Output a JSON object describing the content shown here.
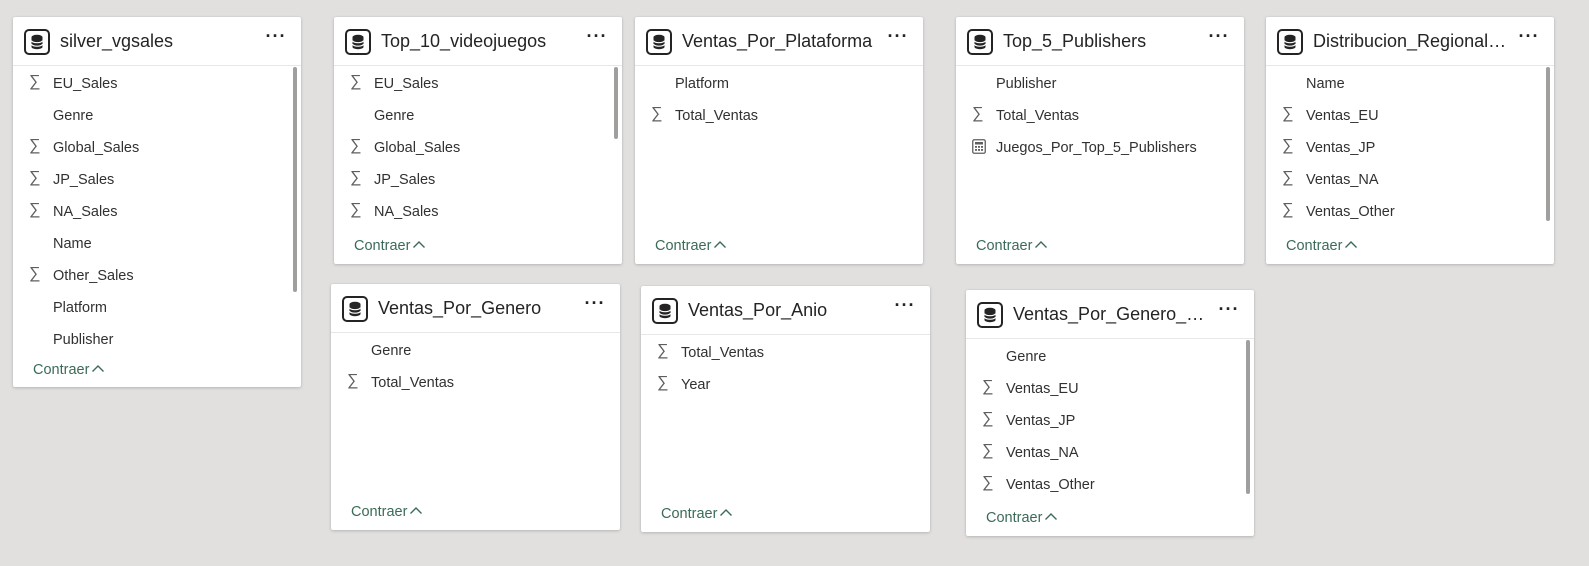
{
  "tables": [
    {
      "title": "silver_vgsales",
      "fields": [
        {
          "name": "EU_Sales",
          "icon": "sigma-icon"
        },
        {
          "name": "Genre",
          "icon": ""
        },
        {
          "name": "Global_Sales",
          "icon": "sigma-icon"
        },
        {
          "name": "JP_Sales",
          "icon": "sigma-icon"
        },
        {
          "name": "NA_Sales",
          "icon": "sigma-icon"
        },
        {
          "name": "Name",
          "icon": ""
        },
        {
          "name": "Other_Sales",
          "icon": "sigma-icon"
        },
        {
          "name": "Platform",
          "icon": ""
        },
        {
          "name": "Publisher",
          "icon": ""
        }
      ],
      "collapse_label": "Contraer"
    },
    {
      "title": "Top_10_videojuegos",
      "fields": [
        {
          "name": "EU_Sales",
          "icon": "sigma-icon"
        },
        {
          "name": "Genre",
          "icon": ""
        },
        {
          "name": "Global_Sales",
          "icon": "sigma-icon"
        },
        {
          "name": "JP_Sales",
          "icon": "sigma-icon"
        },
        {
          "name": "NA_Sales",
          "icon": "sigma-icon"
        }
      ],
      "collapse_label": "Contraer"
    },
    {
      "title": "Ventas_Por_Plataforma",
      "fields": [
        {
          "name": "Platform",
          "icon": ""
        },
        {
          "name": "Total_Ventas",
          "icon": "sigma-icon"
        }
      ],
      "collapse_label": "Contraer"
    },
    {
      "title": "Top_5_Publishers",
      "fields": [
        {
          "name": "Publisher",
          "icon": ""
        },
        {
          "name": "Total_Ventas",
          "icon": "sigma-icon"
        },
        {
          "name": "Juegos_Por_Top_5_Publishers",
          "icon": "calculator-icon"
        }
      ],
      "collapse_label": "Contraer"
    },
    {
      "title": "Distribucion_Regional_V...",
      "fields": [
        {
          "name": "Name",
          "icon": ""
        },
        {
          "name": "Ventas_EU",
          "icon": "sigma-icon"
        },
        {
          "name": "Ventas_JP",
          "icon": "sigma-icon"
        },
        {
          "name": "Ventas_NA",
          "icon": "sigma-icon"
        },
        {
          "name": "Ventas_Other",
          "icon": "sigma-icon"
        }
      ],
      "collapse_label": "Contraer"
    },
    {
      "title": "Ventas_Por_Genero",
      "fields": [
        {
          "name": "Genre",
          "icon": ""
        },
        {
          "name": "Total_Ventas",
          "icon": "sigma-icon"
        }
      ],
      "collapse_label": "Contraer"
    },
    {
      "title": "Ventas_Por_Anio",
      "fields": [
        {
          "name": "Total_Ventas",
          "icon": "sigma-icon"
        },
        {
          "name": "Year",
          "icon": "sigma-icon"
        }
      ],
      "collapse_label": "Contraer"
    },
    {
      "title": "Ventas_Por_Genero_Reg...",
      "fields": [
        {
          "name": "Genre",
          "icon": ""
        },
        {
          "name": "Ventas_EU",
          "icon": "sigma-icon"
        },
        {
          "name": "Ventas_JP",
          "icon": "sigma-icon"
        },
        {
          "name": "Ventas_NA",
          "icon": "sigma-icon"
        },
        {
          "name": "Ventas_Other",
          "icon": "sigma-icon"
        }
      ],
      "collapse_label": "Contraer"
    }
  ],
  "more_glyph": "···",
  "sigma_glyph": "∑",
  "colors": {
    "canvas": "#e1e0df",
    "card": "#ffffff",
    "link": "#3b6b57",
    "text": "#252423"
  }
}
